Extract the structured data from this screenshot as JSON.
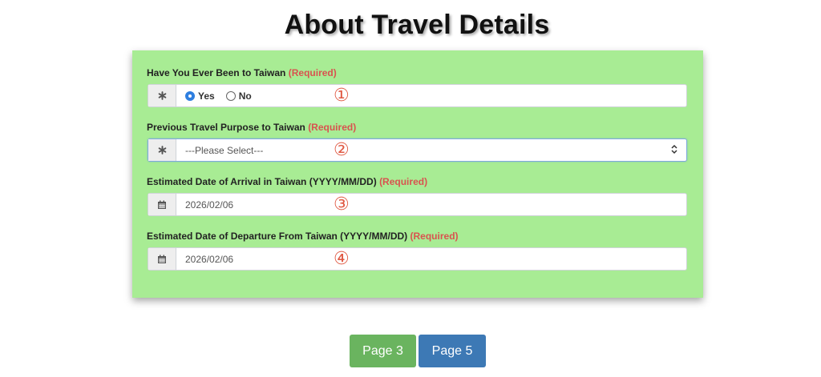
{
  "page": {
    "title": "About Travel Details"
  },
  "form": {
    "required_text": "(Required)",
    "fields": [
      {
        "label": "Have You Ever Been to Taiwan",
        "icon": "asterisk-icon",
        "options": [
          "Yes",
          "No"
        ],
        "selected": "Yes",
        "marker": "①"
      },
      {
        "label": "Previous Travel Purpose to Taiwan",
        "icon": "asterisk-icon",
        "placeholder": "---Please Select---",
        "marker": "②"
      },
      {
        "label": "Estimated Date of Arrival in Taiwan (YYYY/MM/DD)",
        "icon": "calendar-icon",
        "value": "2026/02/06",
        "marker": "③"
      },
      {
        "label": "Estimated Date of Departure From Taiwan (YYYY/MM/DD)",
        "icon": "calendar-icon",
        "value": "2026/02/06",
        "marker": "④"
      }
    ]
  },
  "navigation": {
    "prev_label": "Page 3",
    "next_label": "Page 5"
  },
  "colors": {
    "card_background": "#a8ec94",
    "required": "#d9534f",
    "marker": "#e05a44",
    "prev_button": "#6ab45f",
    "next_button": "#3d79b5"
  }
}
